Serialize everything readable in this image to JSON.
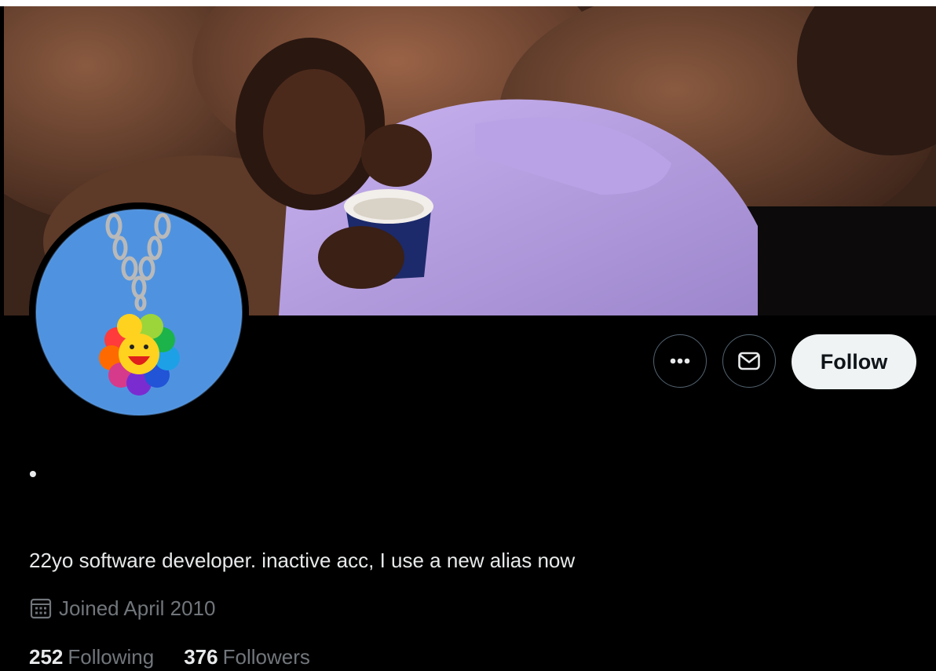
{
  "profile": {
    "display_name": "•",
    "bio": "22yo software developer. inactive acc, I use a new alias now",
    "joined": "Joined April 2010",
    "following_count": "252",
    "following_label": "Following",
    "followers_count": "376",
    "followers_label": "Followers"
  },
  "actions": {
    "more_icon": "more-horizontal-icon",
    "message_icon": "envelope-icon",
    "follow_label": "Follow"
  },
  "icons": {
    "joined": "calendar-icon"
  },
  "colors": {
    "background": "#000000",
    "primary_text": "#e7e9ea",
    "secondary_text": "#71767b",
    "button_border": "#536471",
    "follow_bg": "#eff3f4",
    "follow_text": "#0f1419"
  }
}
